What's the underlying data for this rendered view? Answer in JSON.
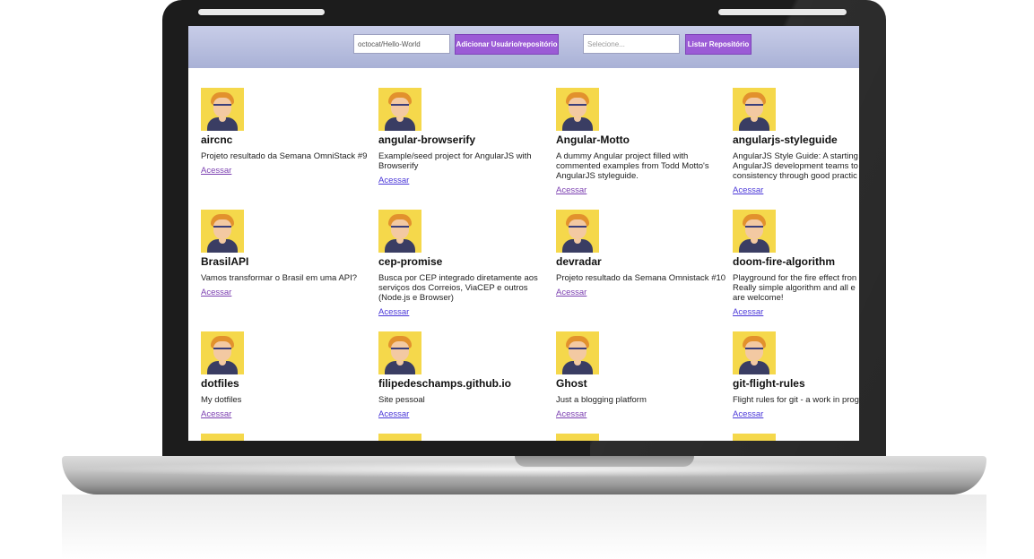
{
  "toolbar": {
    "repo_input_value": "octocat/Hello-World",
    "add_button_label": "Adicionar Usuário/repositório",
    "select_placeholder": "Selecione...",
    "list_button_label": "Listar Repositório"
  },
  "cards": [
    {
      "title": "aircnc",
      "description": "Projeto resultado da Semana OmniStack #9",
      "link": "Acessar"
    },
    {
      "title": "angular-browserify",
      "description": "Example/seed project for AngularJS with\nBrowserify",
      "link": "Acessar"
    },
    {
      "title": "Angular-Motto",
      "description": "A dummy Angular project filled with\ncommented examples from Todd Motto's\nAngularJS styleguide.",
      "link": "Acessar"
    },
    {
      "title": "angularjs-styleguide",
      "description": "AngularJS Style Guide: A starting\nAngularJS development teams to\nconsistency through good practic",
      "link": "Acessar"
    },
    {
      "title": "BrasilAPI",
      "description": "Vamos transformar o Brasil em uma API?",
      "link": "Acessar"
    },
    {
      "title": "cep-promise",
      "description": "Busca por CEP integrado diretamente aos\nserviços dos Correios, ViaCEP e outros\n(Node.js e Browser)",
      "link": "Acessar"
    },
    {
      "title": "devradar",
      "description": "Projeto resultado da Semana Omnistack #10",
      "link": "Acessar"
    },
    {
      "title": "doom-fire-algorithm",
      "description": "Playground for the fire effect fron\nReally simple algorithm and all e\nare welcome!",
      "link": "Acessar"
    },
    {
      "title": "dotfiles",
      "description": "My dotfiles",
      "link": "Acessar"
    },
    {
      "title": "filipedeschamps.github.io",
      "description": "Site pessoal",
      "link": "Acessar"
    },
    {
      "title": "Ghost",
      "description": "Just a blogging platform",
      "link": "Acessar"
    },
    {
      "title": "git-flight-rules",
      "description": "Flight rules for git - a work in prog",
      "link": "Acessar"
    }
  ]
}
